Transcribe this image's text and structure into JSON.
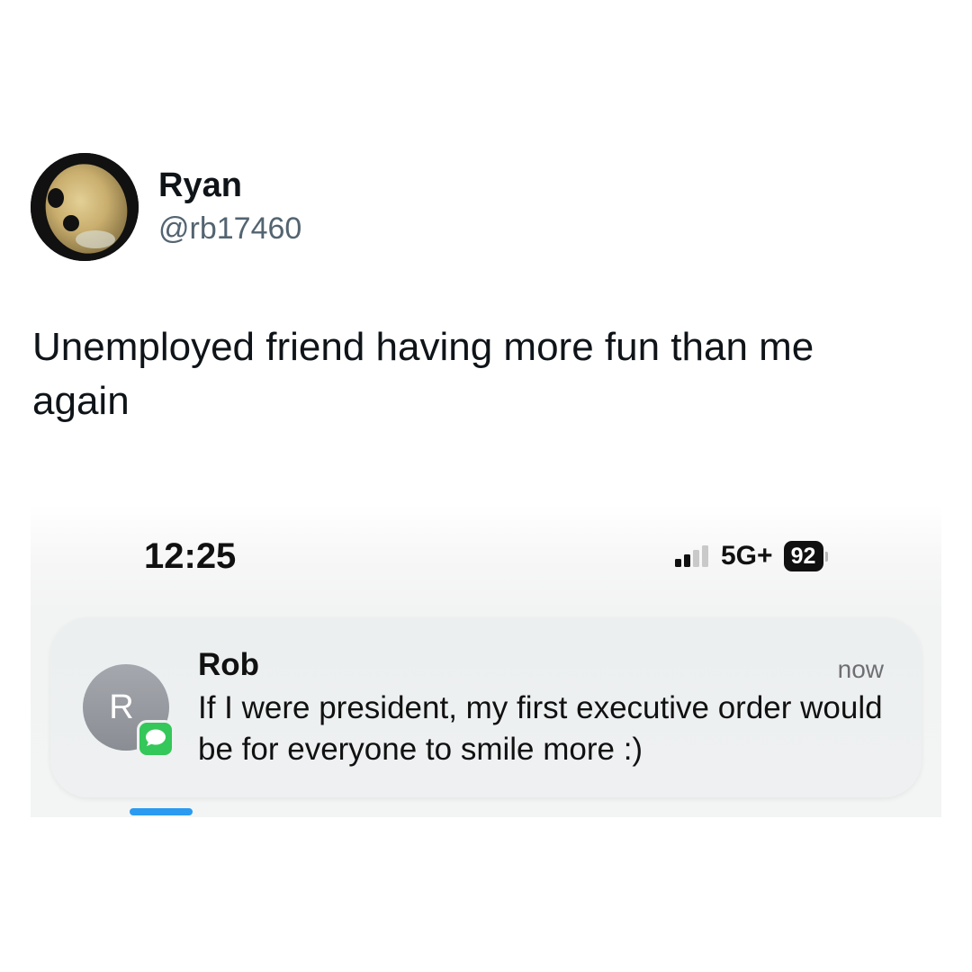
{
  "post": {
    "author_name": "Ryan",
    "author_handle": "@rb17460",
    "text": "Unemployed friend having more fun than me again"
  },
  "phone": {
    "status_bar": {
      "time": "12:25",
      "network": "5G+",
      "battery_percent": "92",
      "signal_bars_active": 2,
      "signal_bars_total": 4
    },
    "notification": {
      "avatar_initial": "R",
      "app_icon": "imessage-icon",
      "sender": "Rob",
      "time": "now",
      "message": "If I were president, my first executive order would be for everyone to smile more :)"
    }
  },
  "colors": {
    "handle_gray": "#536471",
    "imessage_green": "#34c759",
    "indicator_blue": "#2a9bf0"
  }
}
